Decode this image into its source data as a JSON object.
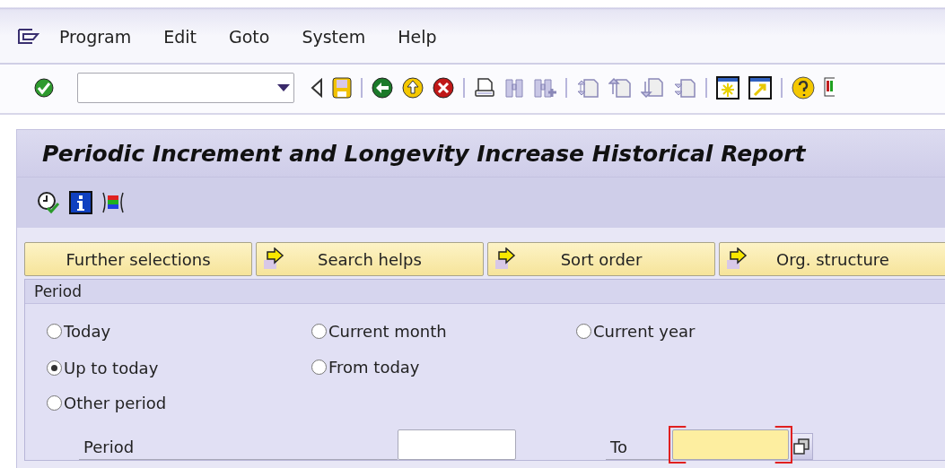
{
  "menu": [
    {
      "label": "Program"
    },
    {
      "label": "Edit"
    },
    {
      "label": "Goto"
    },
    {
      "label": "System"
    },
    {
      "label": "Help"
    }
  ],
  "title": "Periodic Increment and Longevity Increase Historical Report",
  "tab_buttons": [
    {
      "label": "Further selections",
      "kind": "plain"
    },
    {
      "label": "Search helps",
      "kind": "arrow"
    },
    {
      "label": "Sort order",
      "kind": "arrow"
    },
    {
      "label": "Org. structure",
      "kind": "arrow"
    }
  ],
  "period_group": {
    "title": "Period",
    "options": [
      {
        "label": "Today",
        "selected": false
      },
      {
        "label": "Current month",
        "selected": false
      },
      {
        "label": "Current year",
        "selected": false
      },
      {
        "label": "Up to today",
        "selected": true
      },
      {
        "label": "From today",
        "selected": false
      },
      {
        "label": "Other period",
        "selected": false
      }
    ],
    "from_field": {
      "label": "Period"
    },
    "to_field": {
      "label": "To",
      "required": true
    }
  }
}
